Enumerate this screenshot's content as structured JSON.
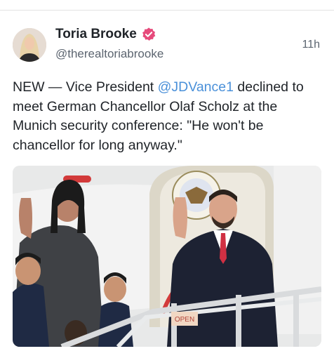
{
  "post": {
    "author_name": "Toria Brooke",
    "author_handle": "@therealtoriabrooke",
    "timestamp": "11h",
    "text_prefix": "NEW — Vice President ",
    "mention": "@JDVance1",
    "text_suffix": " declined to meet German Chancellor Olaf Scholz at the Munich security conference: \"He won't be chancellor for long anyway.\"",
    "verified_badge_color": "#e64a7b",
    "mention_color": "#4a90d9"
  },
  "media": {
    "stair_sign_text": "OPEN"
  }
}
